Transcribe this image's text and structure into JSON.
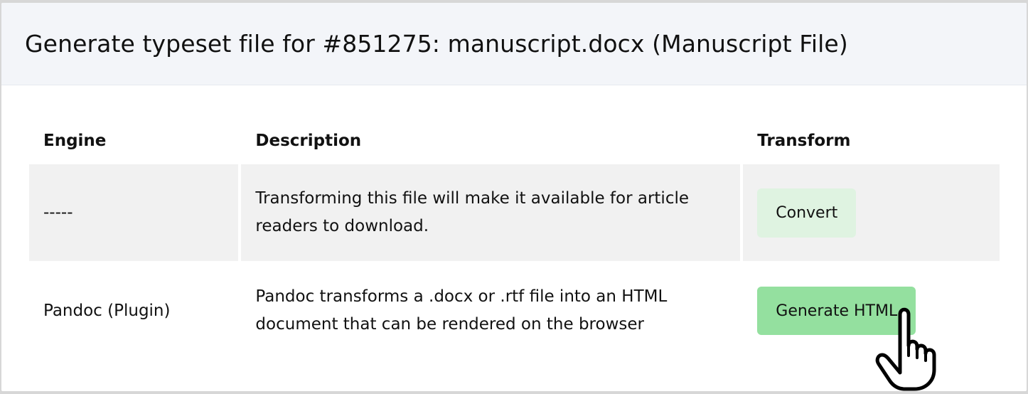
{
  "modal": {
    "title": "Generate typeset file for #851275: manuscript.docx (Manuscript File)"
  },
  "table": {
    "headers": {
      "engine": "Engine",
      "description": "Description",
      "transform": "Transform"
    },
    "rows": [
      {
        "engine": "-----",
        "description": "Transforming this file will make it available for article readers to download.",
        "action_label": "Convert"
      },
      {
        "engine": "Pandoc (Plugin)",
        "description": "Pandoc transforms a .docx or .rtf file into an HTML document that can be rendered on the browser",
        "action_label": "Generate HTML"
      }
    ]
  },
  "colors": {
    "header_bg": "#f3f5f9",
    "row_alt_bg": "#f1f1f1",
    "convert_button": "#dff3e1",
    "generate_button": "#94e09f"
  },
  "cursor": {
    "icon": "hand-pointer-icon"
  }
}
